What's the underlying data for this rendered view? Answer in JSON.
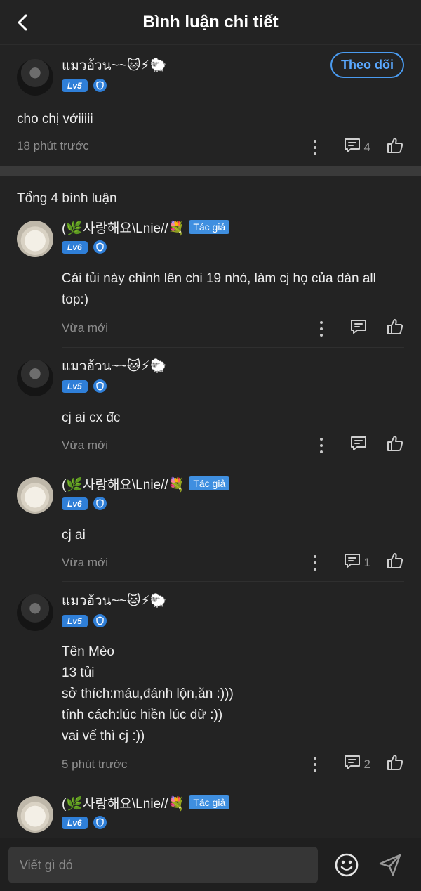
{
  "header": {
    "title": "Bình luận chi tiết"
  },
  "main_comment": {
    "username": "แมวอ้วน~~🐱⚡🐑",
    "level": "Lv5",
    "follow_label": "Theo dõi",
    "text": "cho chị vớiiiii",
    "time": "18 phút trước",
    "reply_count": "4"
  },
  "total_label": "Tổng 4 bình luận",
  "replies": [
    {
      "username": "(🌿사랑해요\\Lnie//💐",
      "author_badge": "Tác giả",
      "level": "Lv6",
      "lines": [
        "Cái tủi này chỉnh lên chi 19 nhó, làm cj họ của dàn all",
        "top:)"
      ],
      "time": "Vừa mới",
      "reply_count": ""
    },
    {
      "username": "แมวอ้วน~~🐱⚡🐑",
      "level": "Lv5",
      "lines": [
        "cj ai cx đc"
      ],
      "time": "Vừa mới",
      "reply_count": ""
    },
    {
      "username": "(🌿사랑해요\\Lnie//💐",
      "author_badge": "Tác giả",
      "level": "Lv6",
      "lines": [
        "cj ai"
      ],
      "time": "Vừa mới",
      "reply_count": "1"
    },
    {
      "username": "แมวอ้วน~~🐱⚡🐑",
      "level": "Lv5",
      "lines": [
        "Tên Mèo",
        "13 tủi",
        "sở thích:máu,đánh lộn,ăn :)))",
        "tính cách:lúc hiền lúc dữ :))",
        "vai vế thì cj :))"
      ],
      "time": "5 phút trước",
      "reply_count": "2"
    },
    {
      "username": "(🌿사랑해요\\Lnie//💐",
      "author_badge": "Tác giả",
      "level": "Lv6"
    }
  ],
  "composer": {
    "placeholder": "Viết gì đó"
  },
  "colors": {
    "accent": "#3f8fe0",
    "background": "#232323",
    "badge_blue": "#2f7fd8"
  },
  "icons": [
    "back-arrow-icon",
    "comment-icon",
    "like-icon",
    "more-dots-icon",
    "shield-icon",
    "emoji-icon",
    "send-icon"
  ]
}
